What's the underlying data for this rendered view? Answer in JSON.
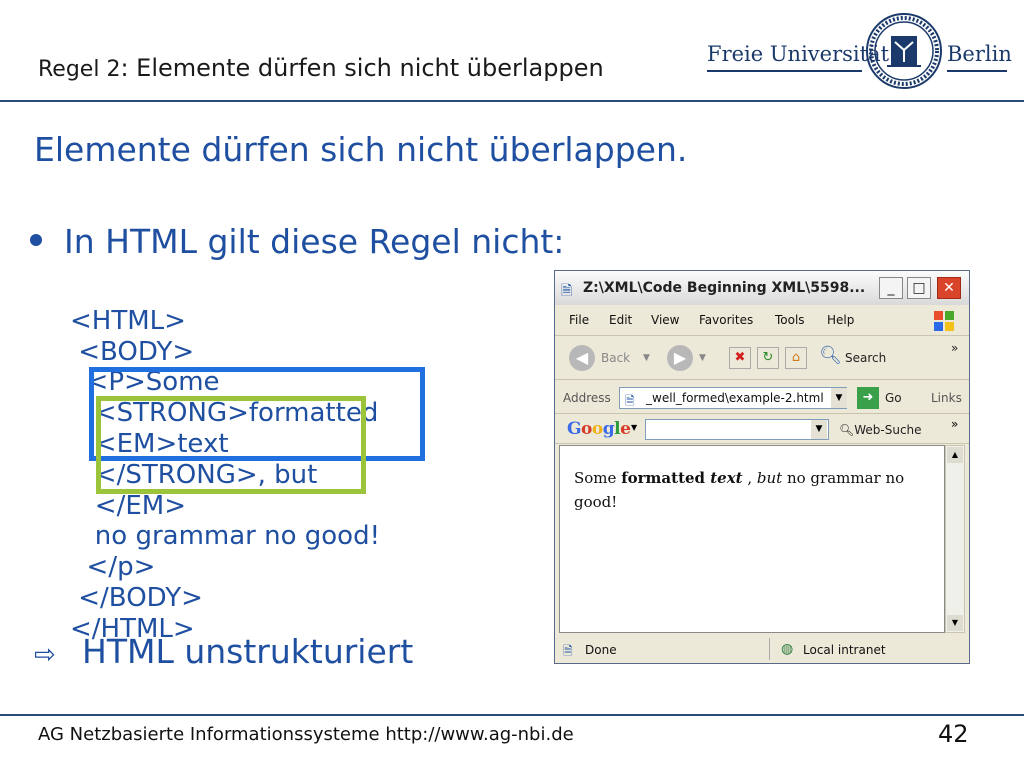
{
  "slide": {
    "header_title_prefix": "Regel 2",
    "header_title_rest": ": Elemente dürfen sich nicht überlappen",
    "heading": "Elemente dürfen sich nicht überlappen.",
    "bullet": "In HTML gilt diese Regel nicht:",
    "code_lines": [
      "<HTML>",
      " <BODY>",
      "  <P>Some",
      "   <STRONG>formatted",
      "   <EM>text",
      "   </STRONG>, but",
      "   </EM>",
      "   no grammar no good!",
      "  </p>",
      " </BODY>",
      "</HTML>"
    ],
    "conclusion": "HTML unstrukturiert",
    "footer": "AG Netzbasierte Informationssysteme http://www.ag-nbi.de",
    "page_number": "42"
  },
  "logo": {
    "left_text": "Freie Universität",
    "right_text": "Berlin"
  },
  "browser": {
    "title": "Z:\\XML\\Code Beginning XML\\5598...",
    "menu": [
      "File",
      "Edit",
      "View",
      "Favorites",
      "Tools",
      "Help"
    ],
    "toolbar": {
      "back": "Back",
      "search": "Search",
      "more": "»"
    },
    "address_label": "Address",
    "address_value": "_well_formed\\example-2.html",
    "go_label": "Go",
    "links_label": "Links",
    "google_label": "Google",
    "web_search": "Web-Suche",
    "page_text": {
      "part1": "Some ",
      "bold": "formatted ",
      "bolditalic": "text",
      "part2": " , ",
      "italic": "but",
      "part3": " no grammar no good!"
    },
    "status_done": "Done",
    "status_zone": "Local intranet"
  },
  "colors": {
    "accent_blue": "#1f4fa0",
    "box_blue": "#1f6fe0",
    "box_green": "#9cc43a"
  }
}
